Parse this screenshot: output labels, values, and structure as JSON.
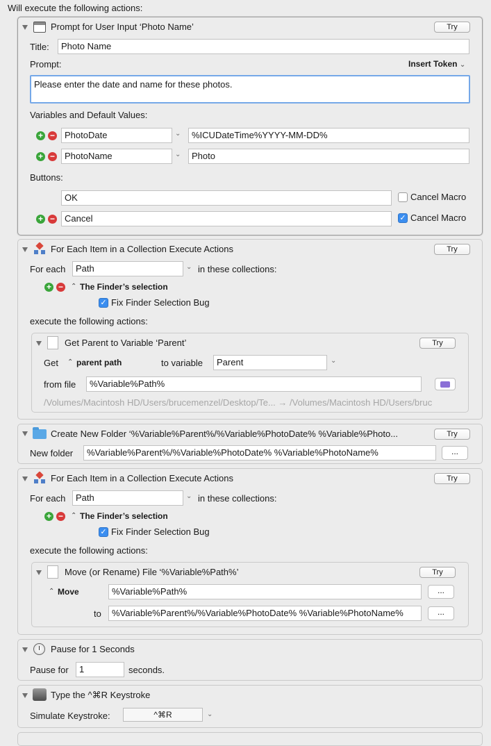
{
  "header": {
    "text": "Will execute the following actions:"
  },
  "common": {
    "try": "Try",
    "dots": "...",
    "chevron": "⌄",
    "updown": "⌃",
    "plus": "+",
    "minus": "−",
    "check": "✓"
  },
  "prompt": {
    "title": "Prompt for User Input ‘Photo Name’",
    "title_label": "Title:",
    "title_value": "Photo Name",
    "prompt_label": "Prompt:",
    "insert_token": "Insert Token",
    "prompt_value": "Please enter the date and name for these photos.",
    "vars_label": "Variables and Default Values:",
    "variables": [
      {
        "name": "PhotoDate",
        "default": "%ICUDateTime%YYYY-MM-DD%"
      },
      {
        "name": "PhotoName",
        "default": "Photo"
      }
    ],
    "buttons_label": "Buttons:",
    "buttons": [
      {
        "value": "OK",
        "cancel_label": "Cancel Macro",
        "cancel_checked": false
      },
      {
        "value": "Cancel",
        "cancel_label": "Cancel Macro",
        "cancel_checked": true
      }
    ]
  },
  "foreach1": {
    "title": "For Each Item in a Collection Execute Actions",
    "for_each_label": "For each",
    "for_each_value": "Path",
    "in_collections": "in these collections:",
    "collection": "The Finder’s selection",
    "fix_bug": "Fix Finder Selection Bug",
    "execute_label": "execute the following actions:",
    "sub": {
      "title": "Get Parent to Variable ‘Parent’",
      "get_label": "Get",
      "get_value": "parent path",
      "to_variable_label": "to variable",
      "to_variable_value": "Parent",
      "from_file_label": "from file",
      "from_file_value": "%Variable%Path%",
      "path_preview": "/Volumes/Macintosh HD/Users/brucemenzel/Desktop/Te... → /Volumes/Macintosh HD/Users/bruc"
    }
  },
  "newfolder": {
    "title": "Create New Folder ‘%Variable%Parent%/%Variable%PhotoDate% %Variable%Photo...",
    "label": "New folder",
    "value": "%Variable%Parent%/%Variable%PhotoDate% %Variable%PhotoName%"
  },
  "foreach2": {
    "title": "For Each Item in a Collection Execute Actions",
    "for_each_label": "For each",
    "for_each_value": "Path",
    "in_collections": "in these collections:",
    "collection": "The Finder’s selection",
    "fix_bug": "Fix Finder Selection Bug",
    "execute_label": "execute the following actions:",
    "sub": {
      "title": "Move (or Rename) File ‘%Variable%Path%’",
      "move_label": "Move",
      "source_value": "%Variable%Path%",
      "to_label": "to",
      "dest_value": "%Variable%Parent%/%Variable%PhotoDate% %Variable%PhotoName%"
    }
  },
  "pause": {
    "title": "Pause for 1 Seconds",
    "label": "Pause for",
    "value": "1",
    "unit": "seconds."
  },
  "keystroke": {
    "title": "Type the ^⌘R Keystroke",
    "label": "Simulate Keystroke:",
    "value": "^⌘R"
  }
}
